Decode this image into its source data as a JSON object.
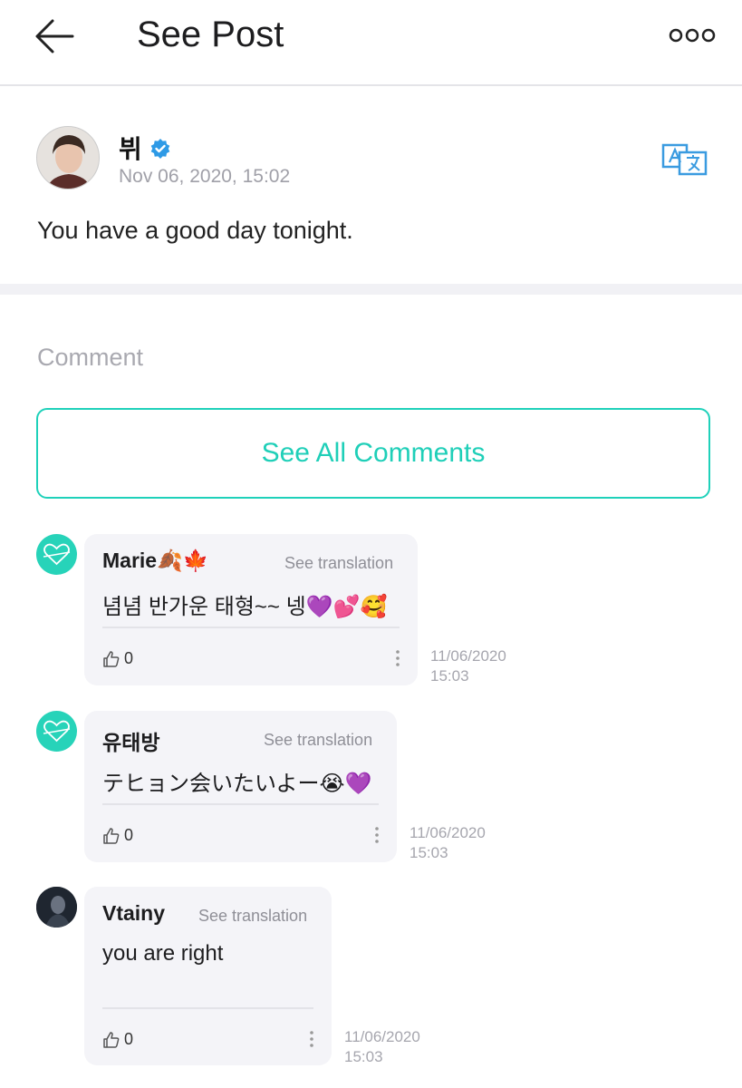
{
  "header": {
    "title": "See Post"
  },
  "post": {
    "author": "뷔",
    "timestamp": "Nov 06, 2020, 15:02",
    "text": "You have a good day tonight."
  },
  "comments_section": {
    "heading": "Comment",
    "see_all_label": "See All Comments"
  },
  "comments": [
    {
      "author": "Marie🍂🍁",
      "translate_label": "See translation",
      "text": "념념 반가운 태형~~ 넹💜💕🥰",
      "likes": "0",
      "date": "11/06/2020",
      "time": "15:03"
    },
    {
      "author": "유태방",
      "translate_label": "See translation",
      "text": "テヒョン会いたいよー😭💜",
      "likes": "0",
      "date": "11/06/2020",
      "time": "15:03"
    },
    {
      "author": "Vtainy",
      "translate_label": "See translation",
      "text": "you are right",
      "likes": "0",
      "date": "11/06/2020",
      "time": "15:03"
    }
  ],
  "colors": {
    "accent": "#1fd1ba",
    "verified": "#2e9ae6",
    "bubble": "#f4f4f8"
  },
  "icons": [
    "back-arrow-icon",
    "more-options-icon",
    "verified-badge-icon",
    "translate-icon",
    "thumbs-up-icon",
    "kebab-menu-icon"
  ]
}
